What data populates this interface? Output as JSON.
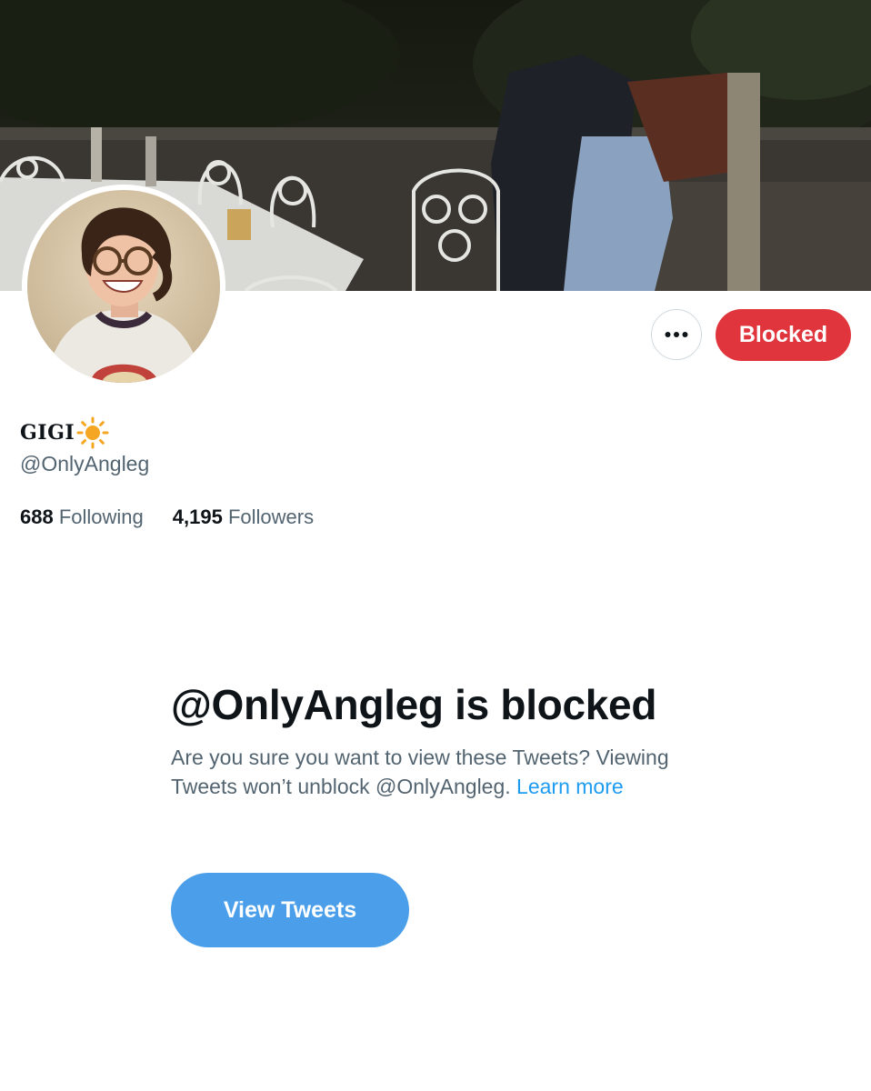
{
  "profile": {
    "display_name": "GIGI",
    "handle": "@OnlyAngleg",
    "following_count": "688",
    "following_label": "Following",
    "followers_count": "4,195",
    "followers_label": "Followers"
  },
  "actions": {
    "more_icon": "more-horizontal-icon",
    "blocked_label": "Blocked"
  },
  "blocked_notice": {
    "title": "@OnlyAngleg is blocked",
    "description": "Are you sure you want to view these Tweets? Viewing Tweets won’t unblock @OnlyAngleg.",
    "learn_more": "Learn more",
    "view_tweets_label": "View Tweets"
  },
  "colors": {
    "blocked_red": "#e0353c",
    "view_button_blue": "#4a9eea",
    "link_blue": "#1d9bf0",
    "secondary_text": "#536471",
    "sun_emoji": "#f5a623"
  }
}
